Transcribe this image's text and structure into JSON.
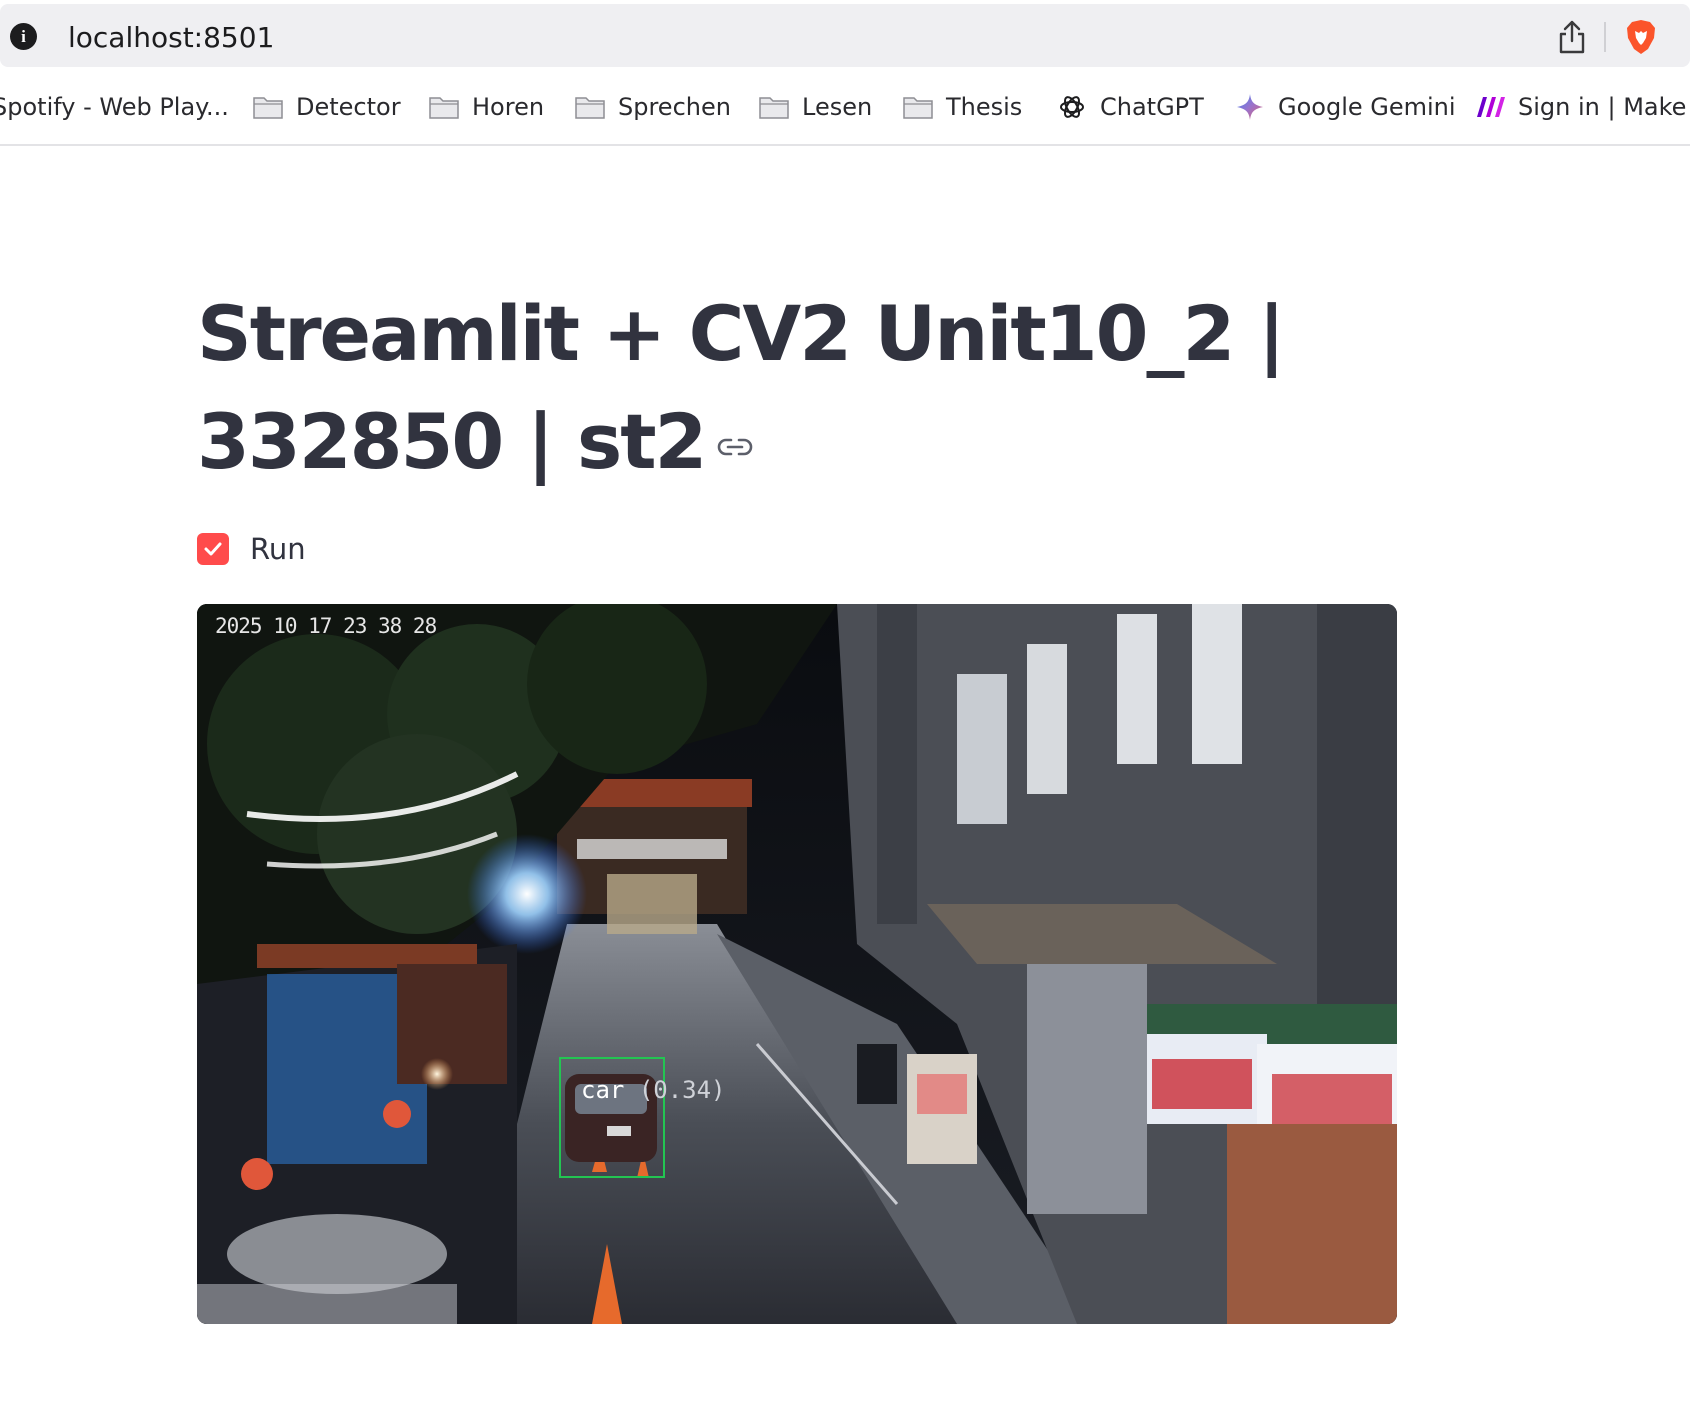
{
  "browser": {
    "url": "localhost:8501",
    "bookmarks": [
      {
        "label": "Spotify - Web Play...",
        "icon": "spotify-icon"
      },
      {
        "label": "Detector",
        "icon": "folder-icon"
      },
      {
        "label": "Horen",
        "icon": "folder-icon"
      },
      {
        "label": "Sprechen",
        "icon": "folder-icon"
      },
      {
        "label": "Lesen",
        "icon": "folder-icon"
      },
      {
        "label": "Thesis",
        "icon": "folder-icon"
      },
      {
        "label": "ChatGPT",
        "icon": "chatgpt-icon"
      },
      {
        "label": "Google Gemini",
        "icon": "gemini-icon"
      },
      {
        "label": "Sign in | Make H",
        "icon": "make-icon"
      }
    ]
  },
  "app": {
    "title": "Streamlit + CV2 Unit10_2 | 332850 | st2",
    "run_checkbox": {
      "label": "Run",
      "checked": true
    },
    "video": {
      "timestamp": "2025 10 17 23 38 28",
      "detection": {
        "label": "car",
        "score": "(0.34)"
      }
    }
  },
  "colors": {
    "accent": "#ff4b4b",
    "text": "#31333f",
    "detection_box": "#23c552"
  }
}
